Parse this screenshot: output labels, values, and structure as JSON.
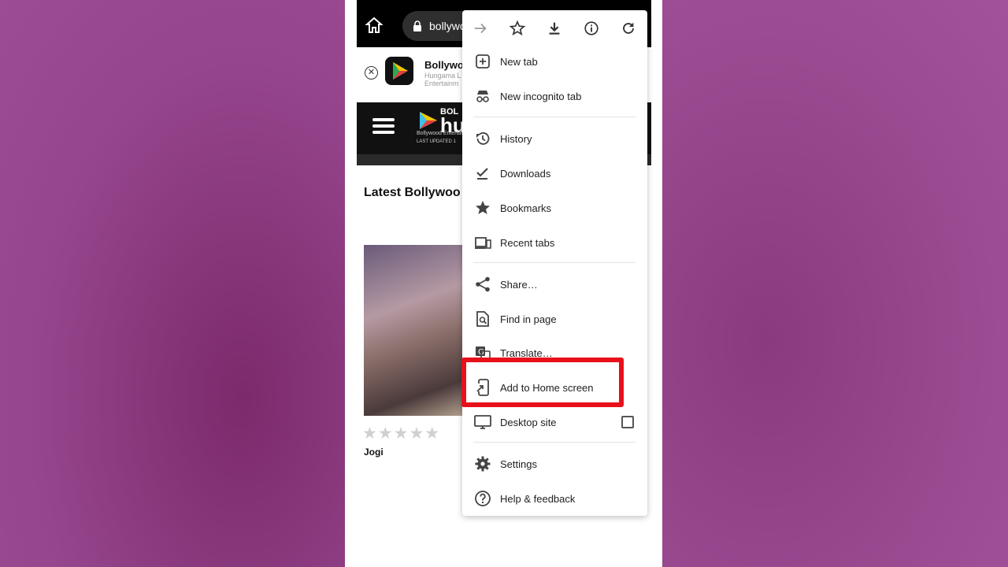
{
  "browser": {
    "url_text": "bollywood",
    "home_icon": "home-icon",
    "lock_icon": "lock-icon"
  },
  "app_banner": {
    "title": "Bollywo",
    "subtitle_line1": "Hungama L",
    "subtitle_line2": "Entertainm",
    "close_icon": "close-icon"
  },
  "site": {
    "name": "hun",
    "logo_top": "BOL",
    "tagline": "Bollywood Entertai",
    "last_updated": "LAST UPDATED 1",
    "section_title": "Latest Bollywoo",
    "movie": {
      "title": "Jogi",
      "rating_stars": 0,
      "rating_max": 5,
      "stars_text": "★★★★★"
    }
  },
  "menu": {
    "top_actions": [
      {
        "name": "forward",
        "icon": "arrow-forward-icon",
        "enabled": false
      },
      {
        "name": "bookmark",
        "icon": "star-outline-icon",
        "enabled": true
      },
      {
        "name": "download",
        "icon": "download-icon",
        "enabled": true
      },
      {
        "name": "page-info",
        "icon": "info-icon",
        "enabled": true
      },
      {
        "name": "reload",
        "icon": "reload-icon",
        "enabled": true
      }
    ],
    "items": [
      {
        "label": "New tab",
        "icon": "new-tab-icon"
      },
      {
        "label": "New incognito tab",
        "icon": "incognito-icon"
      },
      {
        "label": "History",
        "icon": "history-icon"
      },
      {
        "label": "Downloads",
        "icon": "downloads-check-icon"
      },
      {
        "label": "Bookmarks",
        "icon": "star-icon"
      },
      {
        "label": "Recent tabs",
        "icon": "devices-icon"
      },
      {
        "label": "Share…",
        "icon": "share-icon"
      },
      {
        "label": "Find in page",
        "icon": "find-in-page-icon"
      },
      {
        "label": "Translate…",
        "icon": "translate-icon"
      },
      {
        "label": "Add to Home screen",
        "icon": "add-to-home-icon"
      },
      {
        "label": "Desktop site",
        "icon": "desktop-icon",
        "checked": false
      },
      {
        "label": "Settings",
        "icon": "settings-gear-icon"
      },
      {
        "label": "Help & feedback",
        "icon": "help-icon"
      }
    ]
  },
  "highlight": {
    "color": "#e8101b",
    "target": "Add to Home screen"
  }
}
